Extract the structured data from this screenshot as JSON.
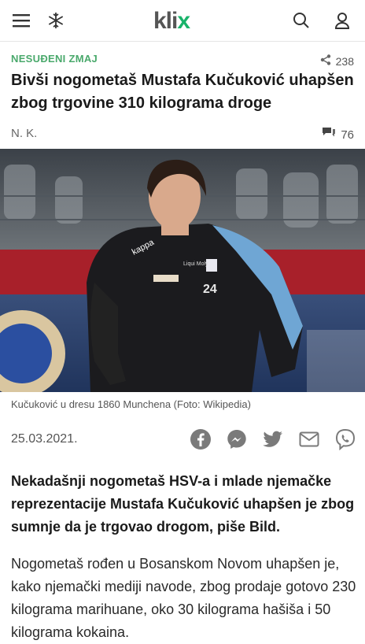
{
  "header": {
    "logo_main": "kli",
    "logo_accent": "x"
  },
  "article": {
    "category": "NESUĐENI ZMAJ",
    "shares": "238",
    "title": "Bivši nogometaš Mustafa Kučuković uhapšen zbog trgovine 310 kilograma droge",
    "author": "N. K.",
    "comments": "76",
    "photo": {
      "caption": "Kučuković u dresu 1860 Munchena (Foto: Wikipedia)",
      "jersey_number": "24",
      "sponsor": "Liqui Moly",
      "brand": "kappa"
    },
    "date": "25.03.2021.",
    "lead": "Nekadašnji nogometaš HSV-a i mlade njemačke reprezentacije Mustafa Kučuković uhapšen je zbog sumnje da je trgovao drogom, piše Bild.",
    "body": "Nogometaš rođen u Bosanskom Novom uhapšen je, kako njemački mediji navode, zbog prodaje gotovo 230 kilograma marihuane, oko 30 kilograma hašiša i 50 kilograma kokaina."
  },
  "colors": {
    "accent": "#4aa96c",
    "logo_x": "#18b36a",
    "icon": "#7a7a7a"
  },
  "icons": [
    "menu-icon",
    "snowflake-icon",
    "search-icon",
    "user-icon",
    "share-icon",
    "comment-icon",
    "facebook-icon",
    "messenger-icon",
    "twitter-icon",
    "email-icon",
    "viber-icon"
  ]
}
